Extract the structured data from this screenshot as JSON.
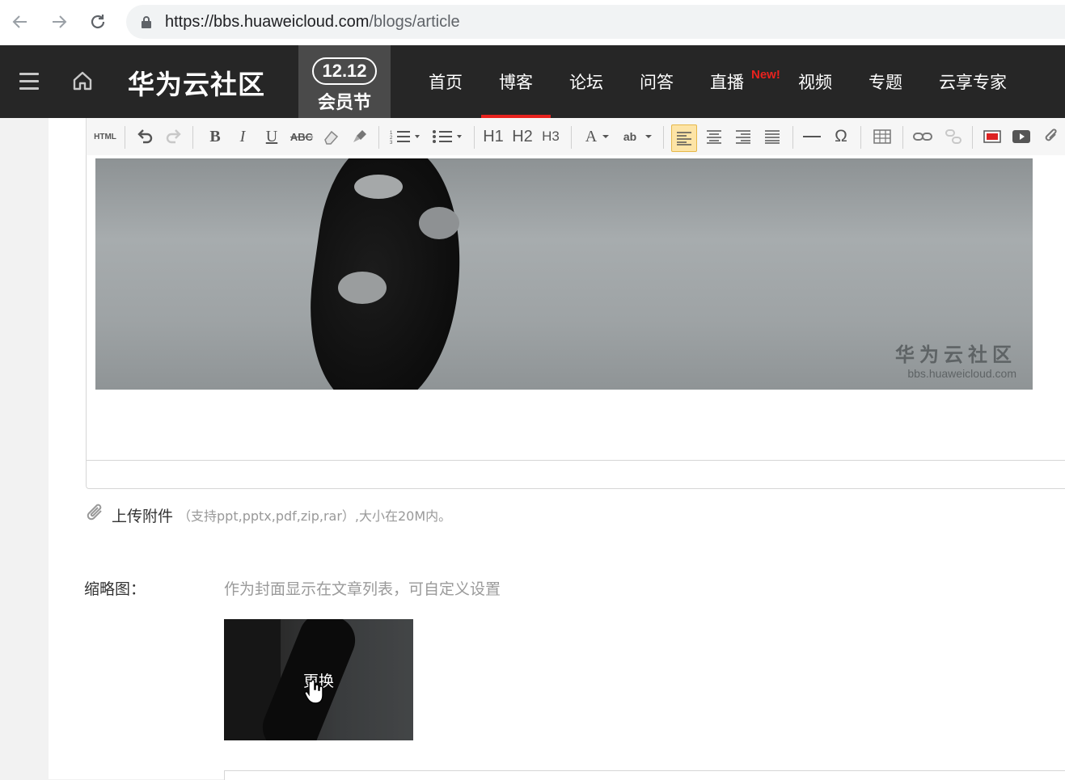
{
  "browser": {
    "url_host": "https://bbs.huaweicloud.com",
    "url_path": "/blogs/article"
  },
  "header": {
    "brand": "华为云社区",
    "promo_number": "12.12",
    "promo_label": "会员节",
    "nav": [
      "首页",
      "博客",
      "论坛",
      "问答",
      "直播",
      "视频",
      "专题",
      "云享专家"
    ],
    "active_nav": "博客",
    "new_badge": "New!"
  },
  "toolbar": {
    "html_label": "HTML",
    "h1": "H1",
    "h2": "H2",
    "h3": "H3",
    "font_color_label": "A",
    "highlight_label": "ab",
    "special_char": "Ω"
  },
  "editor": {
    "watermark_title": "华为云社区",
    "watermark_url": "bbs.huaweicloud.com"
  },
  "attachment": {
    "label": "上传附件",
    "hint": "（支持ppt,pptx,pdf,zip,rar）,大小在20M内。"
  },
  "thumbnail": {
    "label": "缩略图：",
    "hint": "作为封面显示在文章列表，可自定义设置",
    "replace_label": "更换"
  },
  "colors": {
    "header_bg": "#262626",
    "active_underline": "#e8221e",
    "new_badge": "#e8221e"
  }
}
